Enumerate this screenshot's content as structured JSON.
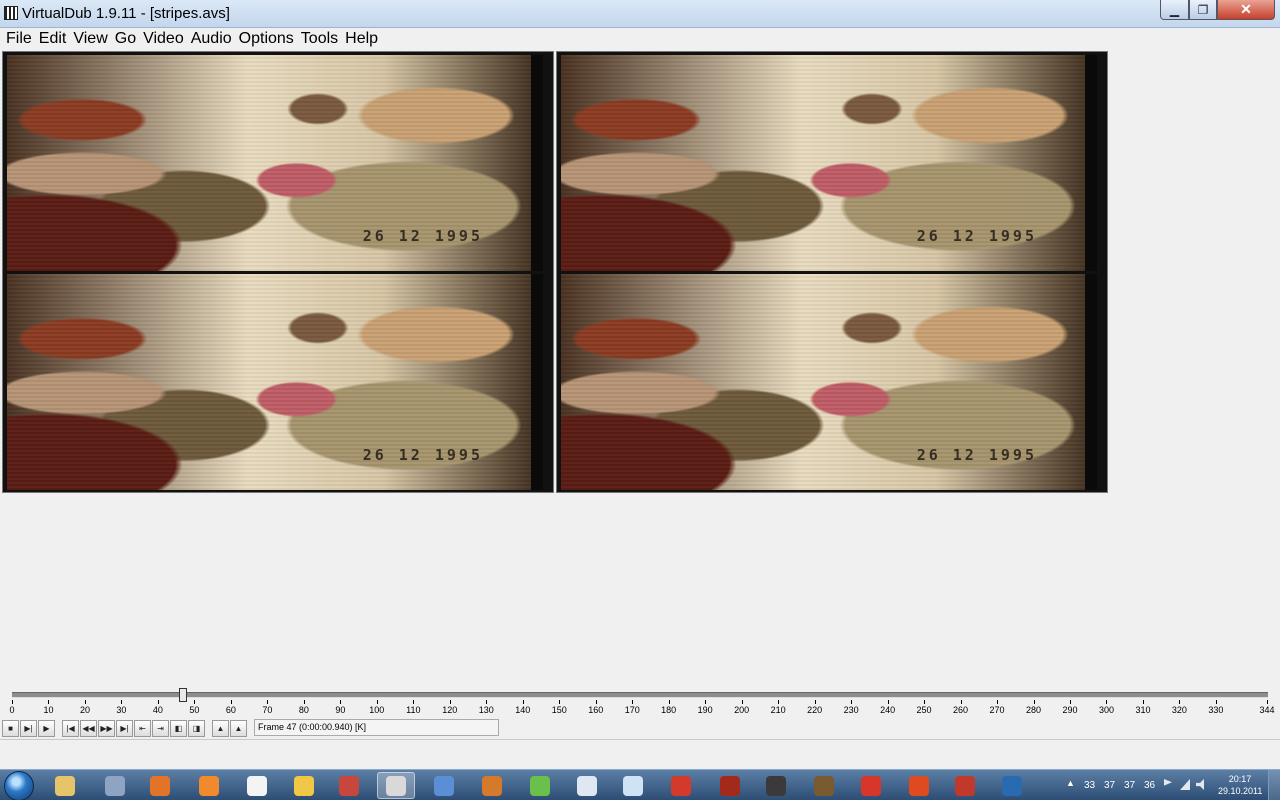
{
  "window": {
    "title": "VirtualDub 1.9.11 - [stripes.avs]",
    "minimize_glyph": "▁",
    "maximize_glyph": "❐",
    "close_glyph": "✕"
  },
  "menu": [
    "File",
    "Edit",
    "View",
    "Go",
    "Video",
    "Audio",
    "Options",
    "Tools",
    "Help"
  ],
  "panes": {
    "input_stamp_top": "26 12 1995",
    "input_stamp_bottom": "26 12 1995",
    "output_stamp_top": "26 12 1995",
    "output_stamp_bottom": "26 12 1995"
  },
  "timeline": {
    "min": 0,
    "max": 344,
    "current_frame": 47,
    "tick_labels": [
      "0",
      "10",
      "20",
      "30",
      "40",
      "50",
      "60",
      "70",
      "80",
      "90",
      "100",
      "110",
      "120",
      "130",
      "140",
      "150",
      "160",
      "170",
      "180",
      "190",
      "200",
      "210",
      "220",
      "230",
      "240",
      "250",
      "260",
      "270",
      "280",
      "290",
      "300",
      "310",
      "320",
      "330",
      "344"
    ],
    "thumb_marker": "1"
  },
  "toolbar": {
    "buttons": [
      {
        "name": "stop-icon",
        "glyph": "■"
      },
      {
        "name": "play-input-icon",
        "glyph": "▶|"
      },
      {
        "name": "play-output-icon",
        "glyph": "▶"
      },
      {
        "name": "go-start-icon",
        "glyph": "|◀"
      },
      {
        "name": "prev-frame-icon",
        "glyph": "◀◀"
      },
      {
        "name": "next-frame-icon",
        "glyph": "▶▶"
      },
      {
        "name": "go-end-icon",
        "glyph": "▶|"
      },
      {
        "name": "prev-key-icon",
        "glyph": "⇤"
      },
      {
        "name": "next-key-icon",
        "glyph": "⇥"
      },
      {
        "name": "prev-scene-icon",
        "glyph": "◧"
      },
      {
        "name": "next-scene-icon",
        "glyph": "◨"
      },
      {
        "name": "mark-in-icon",
        "glyph": "▲"
      },
      {
        "name": "mark-out-icon",
        "glyph": "▲"
      }
    ],
    "frame_info": "Frame 47 (0:00:00.940) [K]"
  },
  "taskbar": {
    "apps": [
      {
        "name": "explorer-icon",
        "color": "#e6c46a"
      },
      {
        "name": "scanner-icon",
        "color": "#8fa4c2"
      },
      {
        "name": "firefox-icon",
        "color": "#e2742a"
      },
      {
        "name": "rss-icon",
        "color": "#f08a2c"
      },
      {
        "name": "calendar-icon",
        "color": "#f4f4f4"
      },
      {
        "name": "pencil-icon",
        "color": "#f0c845"
      },
      {
        "name": "paint-icon",
        "color": "#c9463c"
      },
      {
        "name": "virtualdub-icon",
        "color": "#d9d9d9"
      },
      {
        "name": "yahoo-icon",
        "color": "#5a8fd6"
      },
      {
        "name": "firefox-alt-icon",
        "color": "#d47a2a"
      },
      {
        "name": "puzzle-icon",
        "color": "#6ac04a"
      },
      {
        "name": "usb-icon",
        "color": "#dfe7f2"
      },
      {
        "name": "window-icon",
        "color": "#cfe3f5"
      },
      {
        "name": "opera-icon",
        "color": "#d33a2c"
      },
      {
        "name": "app-red-icon",
        "color": "#a32a1a"
      },
      {
        "name": "te-icon",
        "color": "#3a3a3a"
      },
      {
        "name": "mona-icon",
        "color": "#7a5a30"
      },
      {
        "name": "game-icon",
        "color": "#d8362a"
      },
      {
        "name": "x-icon",
        "color": "#e04a20"
      },
      {
        "name": "flag-icon",
        "color": "#c0392b"
      },
      {
        "name": "disc-icon",
        "color": "#2a6ab0"
      }
    ],
    "tray_numbers": [
      "33",
      "37",
      "37",
      "36"
    ],
    "clock_time": "20:17",
    "clock_date": "29.10.2011"
  }
}
